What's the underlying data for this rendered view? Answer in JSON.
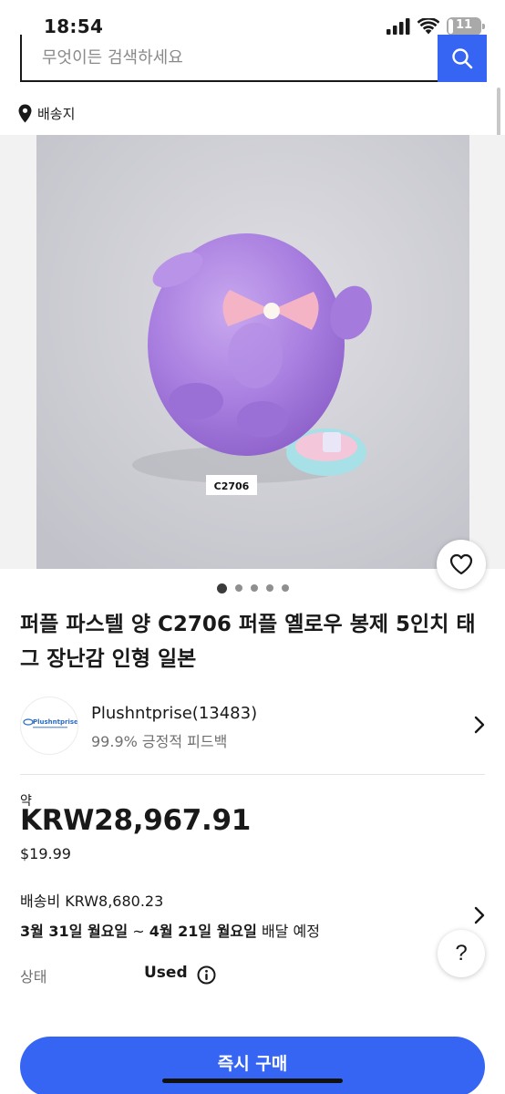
{
  "status_bar": {
    "time": "18:54",
    "battery": "11"
  },
  "search": {
    "placeholder": "무엇이든 검색하세요"
  },
  "ship_to": {
    "label": "배송지"
  },
  "listing": {
    "photo_label": "C2706",
    "carousel": {
      "count": 5,
      "active_index": 0
    },
    "title": "퍼플 파스텔 양 C2706 퍼플 옐로우 봉제 5인치 태그 장난감 인형 일본"
  },
  "seller": {
    "name": "Plushntprise(13483)",
    "feedback": "99.9% 긍정적 피드백",
    "logo_text": "Plushntprise"
  },
  "price": {
    "approx_label": "약",
    "amount": "KRW28,967.91",
    "original": "$19.99"
  },
  "shipping": {
    "cost": "배송비 KRW8,680.23",
    "delivery_start": "3월 31일 월요일",
    "delivery_sep": " ~ ",
    "delivery_end": "4월 21일 월요일",
    "delivery_suffix": " 배달 예정"
  },
  "condition": {
    "label": "상태",
    "value": "Used"
  },
  "help": {
    "label": "?"
  },
  "actions": {
    "buy_now": "즉시 구매"
  },
  "colors": {
    "accent": "#3665f3",
    "text": "#191919",
    "secondary": "#707070"
  },
  "icons": [
    "signal-icon",
    "wifi-icon",
    "battery-icon",
    "search-icon",
    "location-pin-icon",
    "heart-icon",
    "chevron-right-icon",
    "info-icon"
  ]
}
